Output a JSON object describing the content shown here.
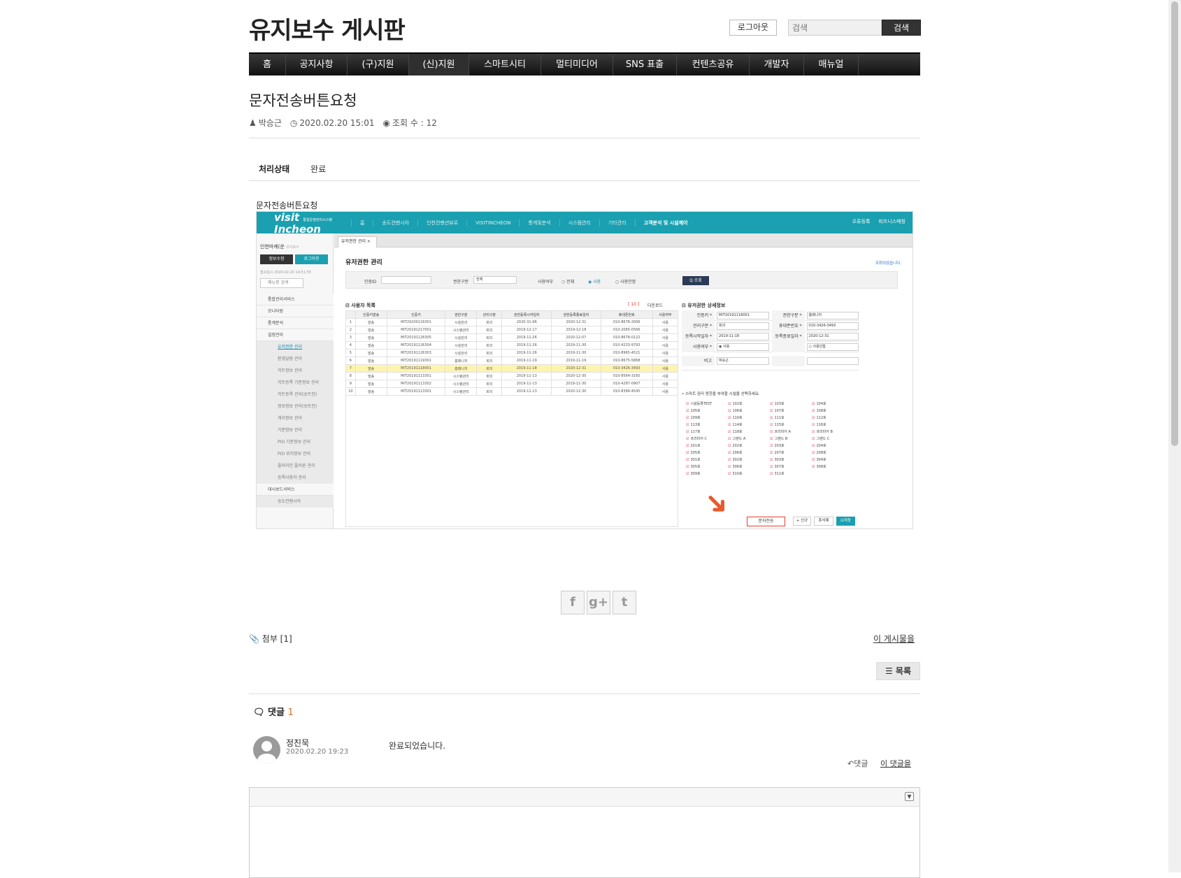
{
  "site": {
    "title": "유지보수 게시판",
    "logout": "로그아웃",
    "search_placeholder": "검색",
    "search_button": "검색"
  },
  "nav": [
    {
      "label": "홈"
    },
    {
      "label": "공지사항"
    },
    {
      "label": "(구)지원"
    },
    {
      "label": "(신)지원"
    },
    {
      "label": "스마트시티"
    },
    {
      "label": "멀티미디어"
    },
    {
      "label": "SNS 표출"
    },
    {
      "label": "컨텐츠공유"
    },
    {
      "label": "개발자"
    },
    {
      "label": "매뉴얼"
    }
  ],
  "post": {
    "title": "문자전송버튼요청",
    "author": "박승근",
    "date": "2020.02.20 15:01",
    "views": "조회 수 : 12",
    "status_label": "처리상태",
    "status_value": "완료",
    "caption": "문자전송버튼요청",
    "attach": "첨부 [1]",
    "this_post": "이 게시물을",
    "list_button": "목록"
  },
  "share": {
    "facebook": "f",
    "google": "g+",
    "twitter": "t"
  },
  "comments": {
    "label": "댓글",
    "count": "1",
    "items": [
      {
        "author": "정진묵",
        "date": "2020.02.20 19:23",
        "text": "완료되었습니다.",
        "reply": "댓글",
        "this_comment": "이 댓글을"
      }
    ]
  },
  "screenshot": {
    "logo": "visit",
    "logo2": "Incheon",
    "logo_sub": "통합운영관리시스템",
    "nav": [
      "홈",
      "송도컨벤시아",
      "인천컨벤션뷰로",
      "VISITINCHEON",
      "통계및분석",
      "시스템관리",
      "기타관리",
      "고객분석 및 시설제어"
    ],
    "right": [
      "오류등록",
      "비즈니스매칭"
    ],
    "side_user": "인천마케(운",
    "side_tag": "유지보수",
    "btn_info": "정보수정",
    "btn_logout": "로그아웃",
    "side_time": "접속일시   2020-02-20 14:51:55",
    "side_search": "메뉴명 검색",
    "menu": [
      "통합관리서비스",
      "모니터링",
      "통계분석",
      "설정관리"
    ],
    "submenu": [
      "유저권한 관리",
      "환경알림 관리",
      "치트정보 관리",
      "치트등록 기준정보 관리",
      "치트등록 관리(송트전)",
      "정보정보 관리(송트전)",
      "게이정보 관리",
      "기준정보 관리",
      "POI 기준정보 관리",
      "POI 위치정보 관리",
      "플러리인 플러른 관리",
      "등록사용자 관리"
    ],
    "menu2": "대시보드서비스",
    "menu2_sub": "송도컨벤시아",
    "tab": "유저권한 관리 ×",
    "heading": "유저권한 관리",
    "breadcrumb": "조회되었습니다.",
    "filter": {
      "id_label": "인증ID",
      "type_label": "권한구분",
      "type_value": "전체",
      "use_label": "사용여부",
      "opt1": "○ 전체",
      "opt2": "◉ 사용",
      "opt3": "○ 사용안함",
      "search": "Q 조회"
    },
    "list_title": "⊟ 사용자 목록",
    "list_count": "[ 10 ]",
    "download": "다운로드",
    "columns": [
      "",
      "인증키발송",
      "인증키",
      "권한구분",
      "관리구분",
      "권한등록시작일자",
      "권한등록종료일자",
      "휴대폰번호",
      "사용여부"
    ],
    "rows": [
      [
        "1",
        "발송",
        "MIT20200116301",
        "시설관리",
        "회의",
        "2020-31-96",
        "2020-12-31",
        "010-8678-2006",
        "사용"
      ],
      [
        "2",
        "발송",
        "MIT20191217001",
        "시스템관리",
        "회의",
        "2019-12-17",
        "2019-12-18",
        "010-2065-0566",
        "사용"
      ],
      [
        "3",
        "발송",
        "MIT20191126305",
        "시설관리",
        "회의",
        "2019-11-26",
        "2020-12-07",
        "010-8678-0122",
        "사용"
      ],
      [
        "4",
        "발송",
        "MIT20191126304",
        "시설관리",
        "회의",
        "2019-11-26",
        "2019-11-30",
        "010-4233-9793",
        "사용"
      ],
      [
        "5",
        "발송",
        "MIT20191126303",
        "시설관리",
        "회의",
        "2019-11-26",
        "2019-11-30",
        "010-8965-4521",
        "사용"
      ],
      [
        "6",
        "발송",
        "MIT20191119301",
        "홈매니저",
        "회의",
        "2019-11-19",
        "2019-11-19",
        "010-8675-5868",
        "사용"
      ],
      [
        "7",
        "발송",
        "MIT20191118001",
        "홈매니저",
        "회의",
        "2019-11-18",
        "2020-12-31",
        "010-3426-3493",
        "사용"
      ],
      [
        "8",
        "발송",
        "MIT20191113301",
        "시스템관리",
        "회의",
        "2019-11-13",
        "2020-12-30",
        "010-8564-3165",
        "사용"
      ],
      [
        "9",
        "발송",
        "MIT20191113302",
        "시스템관리",
        "회의",
        "2019-11-13",
        "2019-11-30",
        "010-4287-0907",
        "사용"
      ],
      [
        "10",
        "발송",
        "MIT20191113301",
        "시스템관리",
        "회의",
        "2019-11-13",
        "2020-12-30",
        "010-8368-4545",
        "사용"
      ]
    ],
    "detail_title": "⊟ 유저권한 상세정보",
    "detail": [
      {
        "l1": "인증키 *",
        "v1": "MIT20191118001",
        "l2": "권한구분 *",
        "v2": "홈매니저"
      },
      {
        "l1": "관리구분 *",
        "v1": "회의",
        "l2": "휴대폰번호 *",
        "v2": "010-3426-3493"
      },
      {
        "l1": "등록시작일자 *",
        "v1": "2019-11-18",
        "l2": "등록종료일자 *",
        "v2": "2020-12-31"
      },
      {
        "l1": "사용여부 *",
        "v1": "◉ 사용",
        "l2": "",
        "v2": "○ 사용안함"
      },
      {
        "l1": "비고",
        "v1": "박승근",
        "l2": "",
        "v2": ""
      }
    ],
    "note": "• 스마트 권리 원한을 부여할 시설을 선택하세요.",
    "checks": [
      "시설등록TEST",
      "102호",
      "103호",
      "104호",
      "105호",
      "106호",
      "107호",
      "108호",
      "109호",
      "110호",
      "111호",
      "112호",
      "113호",
      "114호",
      "115호",
      "116호",
      "117호",
      "118호",
      "프리미어 A",
      "프리미어 B",
      "프리미어 C",
      "그랜드 A",
      "그랜드 B",
      "그랜드 C",
      "201호",
      "202호",
      "203호",
      "204호",
      "205호",
      "206호",
      "207호",
      "208호",
      "301호",
      "302호",
      "303호",
      "304호",
      "305호",
      "306호",
      "307호",
      "308호",
      "309호",
      "310호",
      "311호"
    ],
    "send_button": "문자전송",
    "new_button": "+ 신규",
    "delete_button": "휴삭제",
    "save_button": "⊡저장"
  }
}
